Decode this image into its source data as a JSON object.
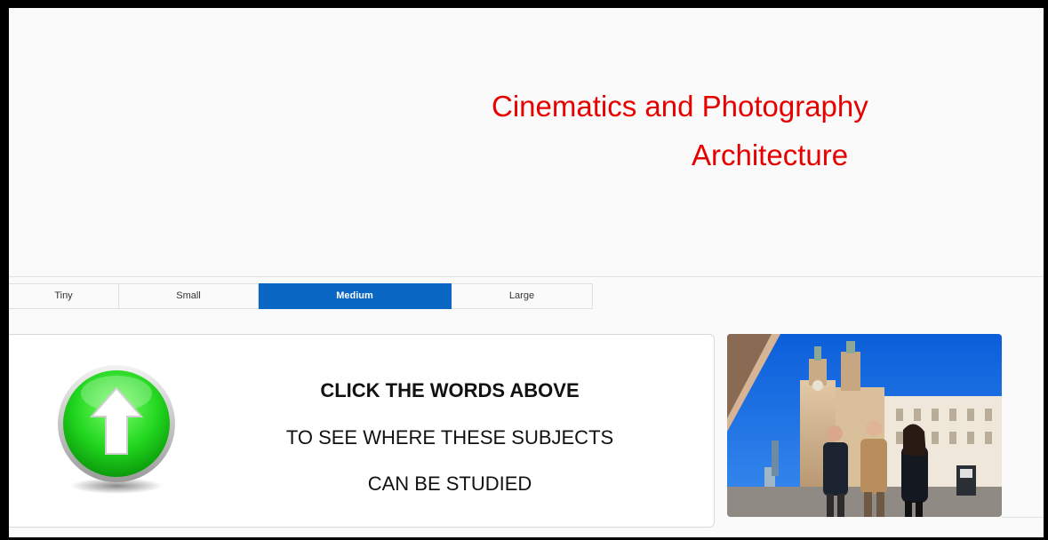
{
  "subjects": [
    "Cinematics and Photography",
    "Architecture"
  ],
  "size_tabs": [
    {
      "label": "Tiny",
      "active": false
    },
    {
      "label": "Small",
      "active": false
    },
    {
      "label": "Medium",
      "active": true
    },
    {
      "label": "Large",
      "active": false
    }
  ],
  "instructions": {
    "line1": "CLICK THE WORDS ABOVE",
    "line2": "TO SEE WHERE THESE SUBJECTS",
    "line3": "CAN BE STUDIED"
  },
  "colors": {
    "subject_link": "#e60000",
    "active_tab": "#0a68c4",
    "arrow_button": "#2fd82f"
  },
  "icons": {
    "arrow": "up-arrow-icon"
  }
}
